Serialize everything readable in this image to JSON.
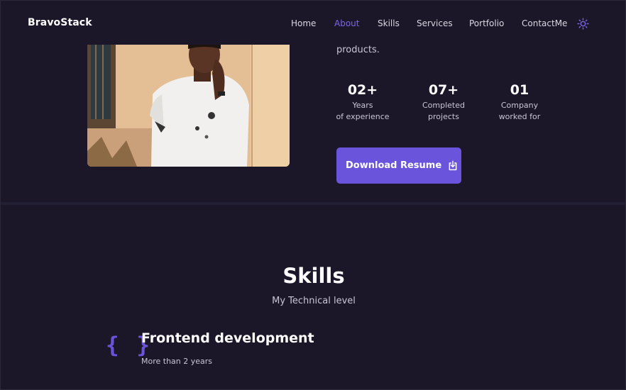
{
  "header": {
    "logo": "BravoStack",
    "nav": [
      {
        "label": "Home",
        "active": false
      },
      {
        "label": "About",
        "active": true
      },
      {
        "label": "Skills",
        "active": false
      },
      {
        "label": "Services",
        "active": false
      },
      {
        "label": "Portfolio",
        "active": false
      },
      {
        "label": "ContactMe",
        "active": false
      }
    ],
    "theme_icon": "sun-icon"
  },
  "about": {
    "text_tail": "products.",
    "stats": [
      {
        "number": "02+",
        "label_line1": "Years",
        "label_line2": "of experience"
      },
      {
        "number": "07+",
        "label_line1": "Completed",
        "label_line2": "projects"
      },
      {
        "number": "01",
        "label_line1": "Company",
        "label_line2": "worked for"
      }
    ],
    "resume_button": "Download Resume",
    "resume_icon": "download-icon"
  },
  "skills": {
    "title": "Skills",
    "subtitle": "My Technical level",
    "items": [
      {
        "icon": "{ }",
        "name": "Frontend development",
        "years": "More than 2 years"
      }
    ]
  },
  "colors": {
    "background": "#1b1728",
    "accent": "#6b54dc",
    "active_link": "#7a67e6",
    "text_muted": "#c8c5d6"
  }
}
